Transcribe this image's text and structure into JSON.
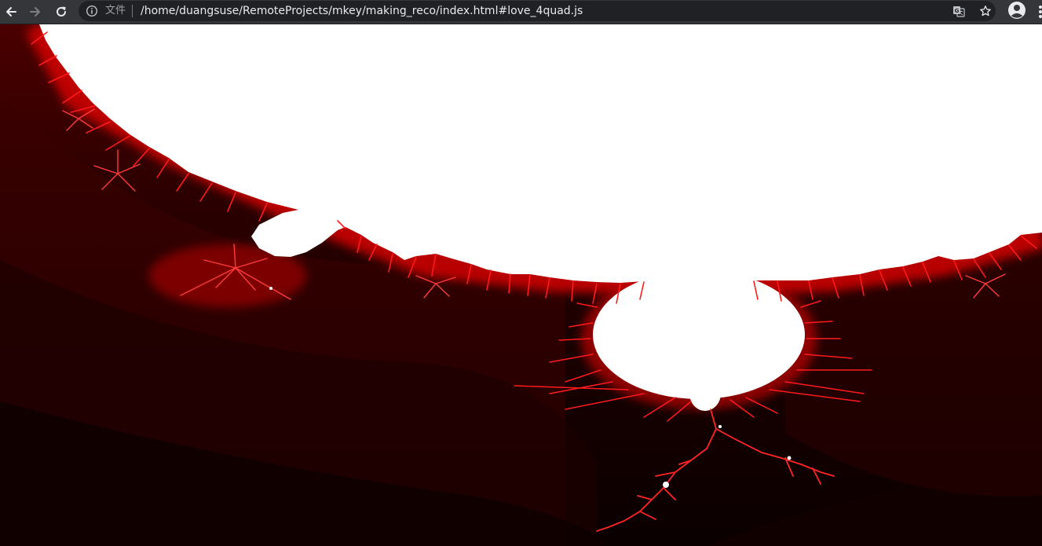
{
  "browser": {
    "navigation": {
      "back_icon": "arrow-left-icon",
      "forward_icon": "arrow-right-icon",
      "reload_icon": "reload-icon"
    },
    "omnibox": {
      "site_info_icon": "info-circle-icon",
      "site_label": "文件",
      "url": "/home/duangsuse/RemoteProjects/mkey/making_reco/index.html#love_4quad.js",
      "translate_icon": "translate-icon",
      "bookmark_icon": "star-icon"
    },
    "profile_icon": "account-circle-icon",
    "menu_icon": "more-vert-icon"
  },
  "page": {
    "content": "mandelbrot-fractal-render",
    "colors": {
      "set_interior": "#ffffff",
      "filament": "#ff1a1a",
      "glow": "#d40000",
      "background_dark": "#0c0000",
      "background_mid": "#3a0000",
      "toolbar": "#35363a",
      "omnibox": "#202124"
    }
  }
}
